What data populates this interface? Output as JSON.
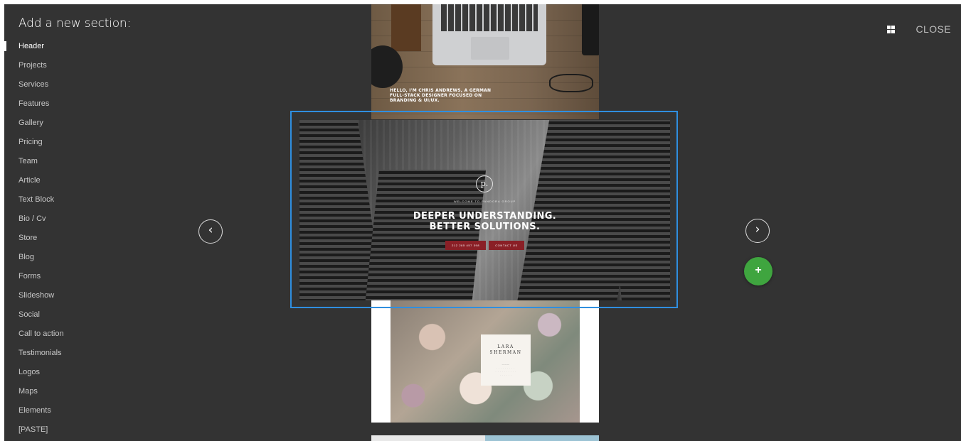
{
  "panel": {
    "title": "Add a new section:",
    "close_label": "CLOSE",
    "grid_icon": "grid-view-icon"
  },
  "sections": [
    {
      "label": "Header",
      "active": true
    },
    {
      "label": "Projects"
    },
    {
      "label": "Services"
    },
    {
      "label": "Features"
    },
    {
      "label": "Gallery"
    },
    {
      "label": "Pricing"
    },
    {
      "label": "Team"
    },
    {
      "label": "Article"
    },
    {
      "label": "Text Block"
    },
    {
      "label": "Bio / Cv"
    },
    {
      "label": "Store"
    },
    {
      "label": "Blog"
    },
    {
      "label": "Forms"
    },
    {
      "label": "Slideshow"
    },
    {
      "label": "Social"
    },
    {
      "label": "Call to action"
    },
    {
      "label": "Testimonials"
    },
    {
      "label": "Logos"
    },
    {
      "label": "Maps"
    },
    {
      "label": "Elements"
    },
    {
      "label": "[PASTE]"
    }
  ],
  "carousel": {
    "prev_arrow": "‹",
    "next_arrow": "›",
    "add_label": "+",
    "top_preview": {
      "text": "HELLO, I'M CHRIS ANDREWS, A GERMAN FULL-STACK DESIGNER FOCUSED ON BRANDING & UI/UX."
    },
    "selected_preview": {
      "logo": "p.",
      "welcome": "WELCOME TO PANDORA GROUP",
      "headline_line1": "DEEPER UNDERSTANDING.",
      "headline_line2": "BETTER SOLUTIONS.",
      "button1": "212 285 457 398",
      "button2": "CONTACT US"
    },
    "bottom_preview": {
      "name_line1": "LARA",
      "name_line2": "SHERMAN"
    }
  },
  "colors": {
    "background": "#333333",
    "selection": "#2f8fe0",
    "add_button": "#3fa53f",
    "hero_button": "#8a1f26"
  }
}
